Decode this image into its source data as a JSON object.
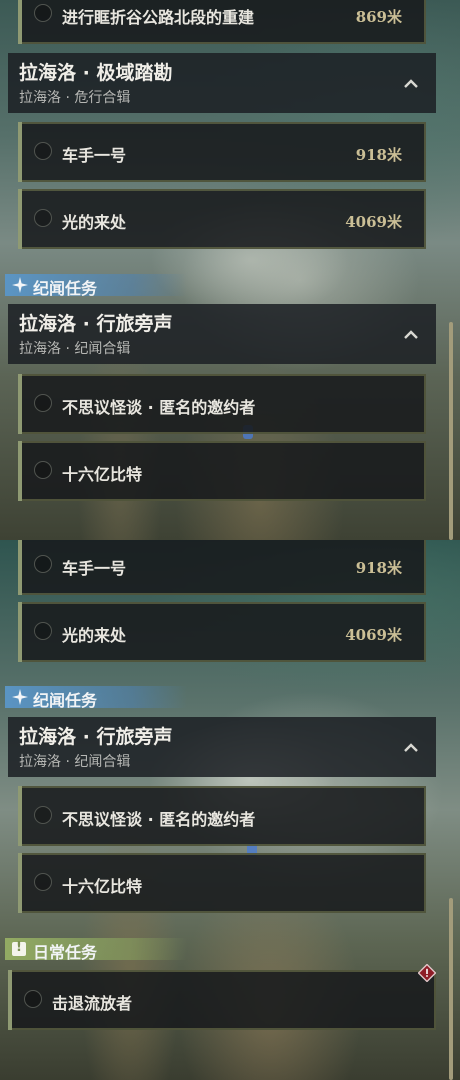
{
  "colors": {
    "accent_blue": "#5a96c8",
    "accent_green": "#96af64",
    "distance": "#cbbf96"
  },
  "top": {
    "item_prev": {
      "name": "进行眶折谷公路北段的重建",
      "distance": "869米"
    },
    "group1": {
      "title": "拉海洛 · 极域踏勘",
      "subtitle": "拉海洛 · 危行合辑"
    },
    "items1": [
      {
        "name": "车手一号",
        "distance": "918米"
      },
      {
        "name": "光的来处",
        "distance": "4069米"
      }
    ],
    "category": {
      "label": "纪闻任务",
      "icon": "sparkle-icon"
    },
    "group2": {
      "title": "拉海洛 · 行旅旁声",
      "subtitle": "拉海洛 · 纪闻合辑"
    },
    "items2": [
      {
        "name": "不思议怪谈 · 匿名的邀约者"
      },
      {
        "name": "十六亿比特"
      }
    ]
  },
  "bottom": {
    "items1": [
      {
        "name": "车手一号",
        "distance": "918米"
      },
      {
        "name": "光的来处",
        "distance": "4069米"
      }
    ],
    "category": {
      "label": "纪闻任务",
      "icon": "sparkle-icon"
    },
    "group": {
      "title": "拉海洛 · 行旅旁声",
      "subtitle": "拉海洛 · 纪闻合辑"
    },
    "items2": [
      {
        "name": "不思议怪谈 · 匿名的邀约者"
      },
      {
        "name": "十六亿比特"
      }
    ],
    "daily": {
      "label": "日常任务",
      "icon": "exclamation-box-icon",
      "icon_glyph": "!"
    },
    "daily_item": {
      "name": "击退流放者"
    }
  }
}
